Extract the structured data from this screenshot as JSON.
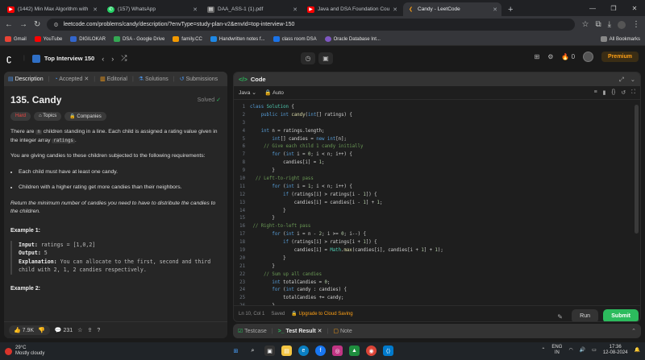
{
  "browser": {
    "tabs": [
      {
        "title": "(1442) Min Max Algorithm with",
        "color": "#ff0000"
      },
      {
        "title": "(157) WhatsApp",
        "color": "#25d366"
      },
      {
        "title": "DAA_ASS-1 (1).pdf",
        "color": "#666666"
      },
      {
        "title": "Java and DSA Foundation Cour",
        "color": "#ff0000"
      },
      {
        "title": "Candy - LeetCode",
        "color": "#ffa116"
      }
    ],
    "url": "leetcode.com/problems/candy/description/?envType=study-plan-v2&envId=top-interview-150",
    "bookmarks": [
      "Gmail",
      "YouTube",
      "DIGILOKAR",
      "DSA - Google Drive",
      "family.CC",
      "Handwritten notes f...",
      "class room DSA",
      "Oracle Database Int..."
    ],
    "all_bookmarks": "All Bookmarks"
  },
  "lcnav": {
    "list_title": "Top Interview 150",
    "streak": "0",
    "premium": "Premium"
  },
  "problem": {
    "tabs": [
      "Description",
      "Accepted",
      "Editorial",
      "Solutions",
      "Submissions"
    ],
    "title": "135. Candy",
    "solved": "Solved",
    "difficulty": "Hard",
    "chip_topics": "Topics",
    "chip_companies": "Companies",
    "p1_a": "There are",
    "p1_n": "n",
    "p1_b": "children standing in a line. Each child is assigned a rating value given in the integer array",
    "p1_arr": "ratings",
    "p2": "You are giving candies to these children subjected to the following requirements:",
    "req1": "Each child must have at least one candy.",
    "req2": "Children with a higher rating get more candies than their neighbors.",
    "p3": "Return the minimum number of candies you need to have to distribute the candies to the children.",
    "example1_title": "Example 1:",
    "ex1_input_label": "Input:",
    "ex1_input": "ratings = [1,0,2]",
    "ex1_output_label": "Output:",
    "ex1_output": "5",
    "ex1_expl_label": "Explanation:",
    "ex1_expl": "You can allocate to the first, second and third child with 2, 1, 2 candies respectively.",
    "example2_title": "Example 2:",
    "likes": "7.9K",
    "comments": "231"
  },
  "editor": {
    "header": "Code",
    "language": "Java",
    "auto": "Auto",
    "status": "Ln 10, Col 1",
    "saved": "Saved",
    "upgrade": "Upgrade to Cloud Saving",
    "run": "Run",
    "submit": "Submit",
    "lines": [
      "class Solution {",
      "    public int candy(int[] ratings) {",
      "",
      "    int n = ratings.length;",
      "        int[] candies = new int[n];",
      "     // Give each child 1 candy initially",
      "        for (int i = 0; i < n; i++) {",
      "            candies[i] = 1;",
      "        }",
      "  // Left-to-right pass",
      "        for (int i = 1; i < n; i++) {",
      "            if (ratings[i] > ratings[i - 1]) {",
      "                candies[i] = candies[i - 1] + 1;",
      "            }",
      "        }",
      " // Right-to-left pass",
      "        for (int i = n - 2; i >= 0; i--) {",
      "            if (ratings[i] > ratings[i + 1]) {",
      "                candies[i] = Math.max(candies[i], candies[i + 1] + 1);",
      "            }",
      "        }",
      "     // Sum up all candies",
      "        int totalCandies = 0;",
      "        for (int candy : candies) {",
      "            totalCandies += candy;",
      "        }"
    ]
  },
  "testpanel": {
    "testcase": "Testcase",
    "result": "Test Result",
    "note": "Note"
  },
  "taskbar": {
    "temp": "29°C",
    "weather": "Mostly cloudy",
    "lang1": "ENG",
    "lang2": "IN",
    "time": "17:36",
    "date": "12-08-2024"
  }
}
